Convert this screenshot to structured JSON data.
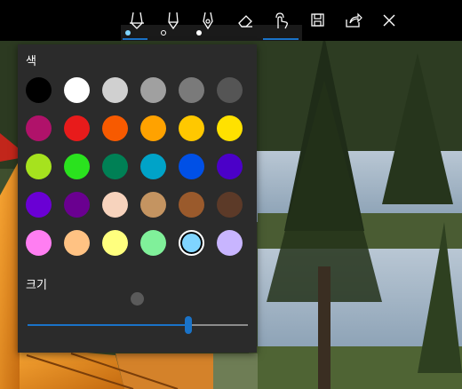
{
  "toolbar": {
    "tools": [
      {
        "name": "ballpoint-pen",
        "icon": "ballpoint-pen-icon"
      },
      {
        "name": "pencil",
        "icon": "pencil-icon"
      },
      {
        "name": "calligraphy-pen",
        "icon": "calligraphy-pen-icon"
      },
      {
        "name": "eraser",
        "icon": "eraser-icon"
      },
      {
        "name": "touch-writing",
        "icon": "touch-writing-icon"
      },
      {
        "name": "save-copy",
        "icon": "save-copy-icon"
      },
      {
        "name": "share",
        "icon": "share-icon"
      },
      {
        "name": "close",
        "icon": "close-icon"
      }
    ],
    "pen_ink_colors": [
      "#7fd4ff",
      "#1a1a1a",
      "#ffffff"
    ],
    "accent": "#1a73c8"
  },
  "flyout": {
    "color_label": "색",
    "size_label": "크기",
    "colors": [
      "#000000",
      "#ffffff",
      "#d0d0d0",
      "#a0a0a0",
      "#7a7a7a",
      "#555555",
      "#b0126a",
      "#e81b1b",
      "#f75a00",
      "#ffa200",
      "#ffc800",
      "#ffe100",
      "#a6e21e",
      "#2ae21e",
      "#008055",
      "#00a3c8",
      "#0050e6",
      "#4b00c8",
      "#6a00d4",
      "#6a0090",
      "#f7d3bd",
      "#c49461",
      "#9a5a2c",
      "#5c3a28",
      "#ff7ef2",
      "#ffc283",
      "#ffff7e",
      "#80f09a",
      "#7fd4ff",
      "#c8b5ff"
    ],
    "selected_color_index": 28,
    "size_value": 0.73
  }
}
